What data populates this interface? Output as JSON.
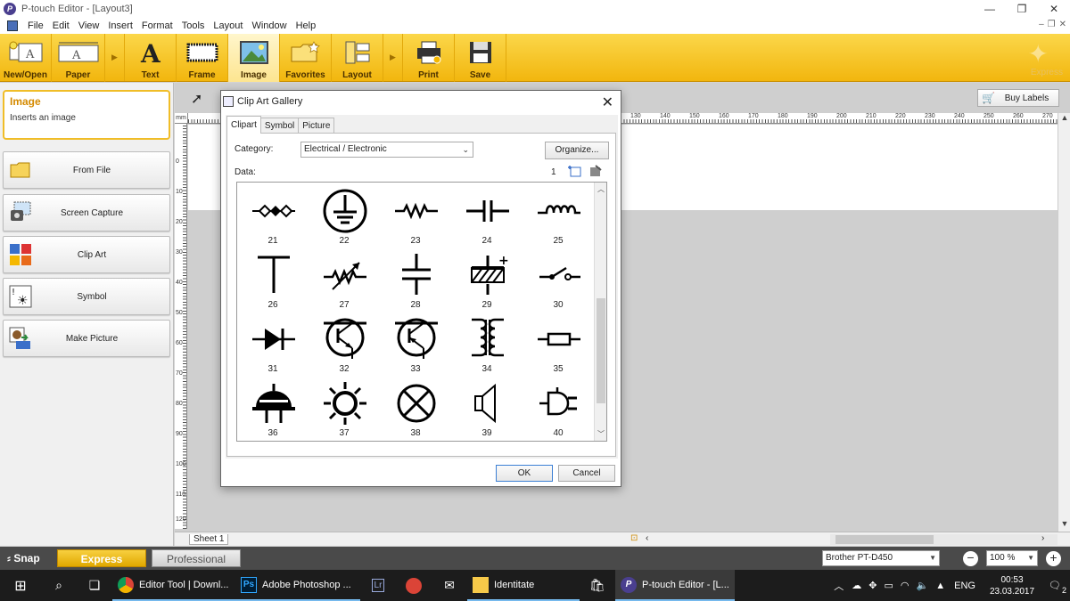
{
  "window": {
    "title": "P-touch Editor - [Layout3]"
  },
  "menu": [
    "File",
    "Edit",
    "View",
    "Insert",
    "Format",
    "Tools",
    "Layout",
    "Window",
    "Help"
  ],
  "ribbon": {
    "buttons": [
      {
        "label": "New/Open"
      },
      {
        "label": "Paper"
      },
      {
        "label": "Text"
      },
      {
        "label": "Frame"
      },
      {
        "label": "Image"
      },
      {
        "label": "Favorites"
      },
      {
        "label": "Layout"
      },
      {
        "label": "Print"
      },
      {
        "label": "Save"
      }
    ],
    "mode": "Express",
    "active": "Image"
  },
  "left_panel": {
    "title": "Image",
    "description": "Inserts an image",
    "buttons": [
      "From File",
      "Screen Capture",
      "Clip Art",
      "Symbol",
      "Make Picture"
    ]
  },
  "workspace": {
    "unit": "mm",
    "buy_labels": "Buy Labels",
    "hruler": [
      "130",
      "140",
      "150",
      "160",
      "170",
      "180",
      "190",
      "200",
      "210",
      "220",
      "230",
      "240",
      "250",
      "260",
      "270"
    ],
    "vruler": [
      "0",
      "10",
      "20",
      "30",
      "40",
      "50",
      "60",
      "70",
      "80",
      "90",
      "100",
      "110",
      "120"
    ],
    "sheet_tab": "Sheet 1"
  },
  "dialog": {
    "title": "Clip Art Gallery",
    "tabs": [
      "Clipart",
      "Symbol",
      "Picture"
    ],
    "selected_tab": "Clipart",
    "category_label": "Category:",
    "category_value": "Electrical / Electronic",
    "organize_label": "Organize...",
    "data_label": "Data:",
    "count": "1",
    "items": [
      "21",
      "22",
      "23",
      "24",
      "25",
      "26",
      "27",
      "28",
      "29",
      "30",
      "31",
      "32",
      "33",
      "34",
      "35",
      "36",
      "37",
      "38",
      "39",
      "40"
    ],
    "ok_label": "OK",
    "cancel_label": "Cancel"
  },
  "statusbar": {
    "snap": "Snap",
    "express": "Express",
    "professional": "Professional",
    "printer": "Brother PT-D450",
    "zoom": "100 %"
  },
  "taskbar": {
    "apps": [
      {
        "label": "Editor Tool | Downl..."
      },
      {
        "label": "Adobe Photoshop ..."
      },
      {
        "label": "Identitate"
      },
      {
        "label": "P-touch Editor - [L..."
      }
    ],
    "language": "ENG",
    "time": "00:53",
    "date": "23.03.2017",
    "notifications": "2"
  },
  "colors": {
    "ribbon": "#f2b60e",
    "accent": "#d48a00",
    "taskbar": "#1c1c1c"
  }
}
